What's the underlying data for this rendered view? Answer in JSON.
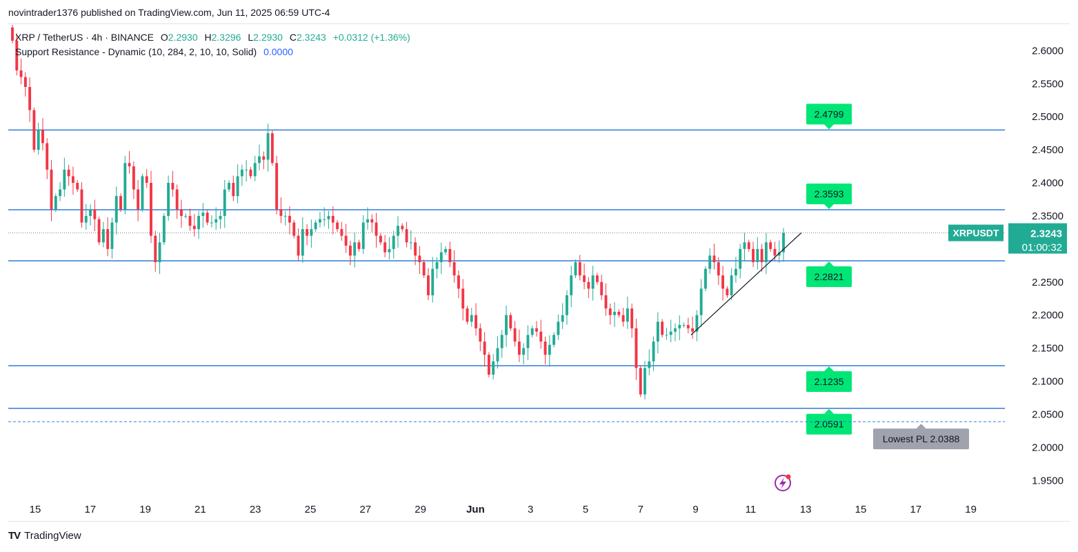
{
  "header": {
    "published_by": "novintrader1376 published on TradingView.com, Jun 11, 2025 06:59 UTC-4"
  },
  "legend": {
    "symbol_line": "XRP / TetherUS · 4h · BINANCE",
    "open_label": "O",
    "open": "2.2930",
    "high_label": "H",
    "high": "2.3296",
    "low_label": "L",
    "low": "2.2930",
    "close_label": "C",
    "close": "2.3243",
    "change": "+0.0312 (+1.36%)",
    "indicator_name": "Support Resistance - Dynamic (10, 284, 2, 10, 10, Solid)",
    "indicator_value": "0.0000"
  },
  "footer": {
    "brand": "TradingView",
    "brand_mark": "TV"
  },
  "colors": {
    "up": "#22ab94",
    "down": "#f23645",
    "level_line": "#2f7bd5",
    "level_label_bg": "#00e676",
    "current_price_bg": "#22ab94",
    "lowest_pl_bg": "#a0a3ad",
    "axis_text": "#131722",
    "grid": "#f0f3fa"
  },
  "chart_data": {
    "type": "candlestick",
    "symbol": "XRPUSDT",
    "timeframe": "4h",
    "x_tick_labels": [
      "15",
      "17",
      "19",
      "21",
      "23",
      "25",
      "27",
      "29",
      "Jun",
      "3",
      "5",
      "7",
      "9",
      "11",
      "13",
      "15",
      "17",
      "19"
    ],
    "y_tick_labels": [
      "2.6000",
      "2.5500",
      "2.5000",
      "2.4500",
      "2.4000",
      "2.3500",
      "2.3000",
      "2.2500",
      "2.2000",
      "2.1500",
      "2.1000",
      "2.0500",
      "2.0000",
      "1.9500"
    ],
    "ylim": [
      1.92,
      2.64
    ],
    "support_resistance_levels": [
      2.4799,
      2.3593,
      2.2821,
      2.1235,
      2.0591
    ],
    "level_labels": [
      "2.4799",
      "2.3593",
      "2.2821",
      "2.1235",
      "2.0591"
    ],
    "lowest_pl": {
      "label": "Lowest PL 2.0388",
      "value": 2.0388
    },
    "current_price": {
      "symbol_label": "XRPUSDT",
      "value": "2.3243",
      "countdown": "01:00:32"
    },
    "trendline": {
      "start": [
        "2025-06-07 20:00",
        2.17
      ],
      "end": [
        "2025-06-11 20:00",
        2.31
      ]
    },
    "candle_closes": [
      2.615,
      2.57,
      2.56,
      2.545,
      2.51,
      2.45,
      2.48,
      2.46,
      2.42,
      2.36,
      2.38,
      2.39,
      2.42,
      2.41,
      2.4,
      2.39,
      2.34,
      2.35,
      2.36,
      2.345,
      2.31,
      2.33,
      2.3,
      2.34,
      2.38,
      2.36,
      2.43,
      2.425,
      2.39,
      2.36,
      2.41,
      2.4,
      2.32,
      2.28,
      2.31,
      2.35,
      2.4,
      2.39,
      2.36,
      2.35,
      2.35,
      2.335,
      2.33,
      2.35,
      2.355,
      2.34,
      2.34,
      2.345,
      2.35,
      2.39,
      2.4,
      2.38,
      2.41,
      2.42,
      2.42,
      2.41,
      2.43,
      2.44,
      2.435,
      2.475,
      2.43,
      2.36,
      2.35,
      2.35,
      2.34,
      2.32,
      2.29,
      2.33,
      2.32,
      2.33,
      2.34,
      2.345,
      2.345,
      2.35,
      2.34,
      2.33,
      2.32,
      2.305,
      2.29,
      2.31,
      2.3,
      2.34,
      2.345,
      2.34,
      2.32,
      2.31,
      2.295,
      2.3,
      2.32,
      2.335,
      2.33,
      2.31,
      2.31,
      2.29,
      2.28,
      2.26,
      2.23,
      2.27,
      2.28,
      2.295,
      2.3,
      2.28,
      2.26,
      2.24,
      2.21,
      2.19,
      2.2,
      2.18,
      2.16,
      2.14,
      2.11,
      2.13,
      2.15,
      2.17,
      2.2,
      2.18,
      2.16,
      2.14,
      2.15,
      2.17,
      2.18,
      2.175,
      2.16,
      2.14,
      2.155,
      2.17,
      2.19,
      2.2,
      2.23,
      2.26,
      2.28,
      2.26,
      2.25,
      2.24,
      2.26,
      2.25,
      2.23,
      2.21,
      2.2,
      2.205,
      2.2,
      2.19,
      2.21,
      2.18,
      2.12,
      2.08,
      2.12,
      2.13,
      2.16,
      2.19,
      2.17,
      2.17,
      2.175,
      2.18,
      2.185,
      2.185,
      2.18,
      2.175,
      2.2,
      2.24,
      2.27,
      2.29,
      2.28,
      2.26,
      2.24,
      2.23,
      2.26,
      2.27,
      2.3,
      2.31,
      2.3,
      2.28,
      2.3,
      2.28,
      2.31,
      2.3,
      2.29,
      2.295,
      2.3243
    ]
  }
}
